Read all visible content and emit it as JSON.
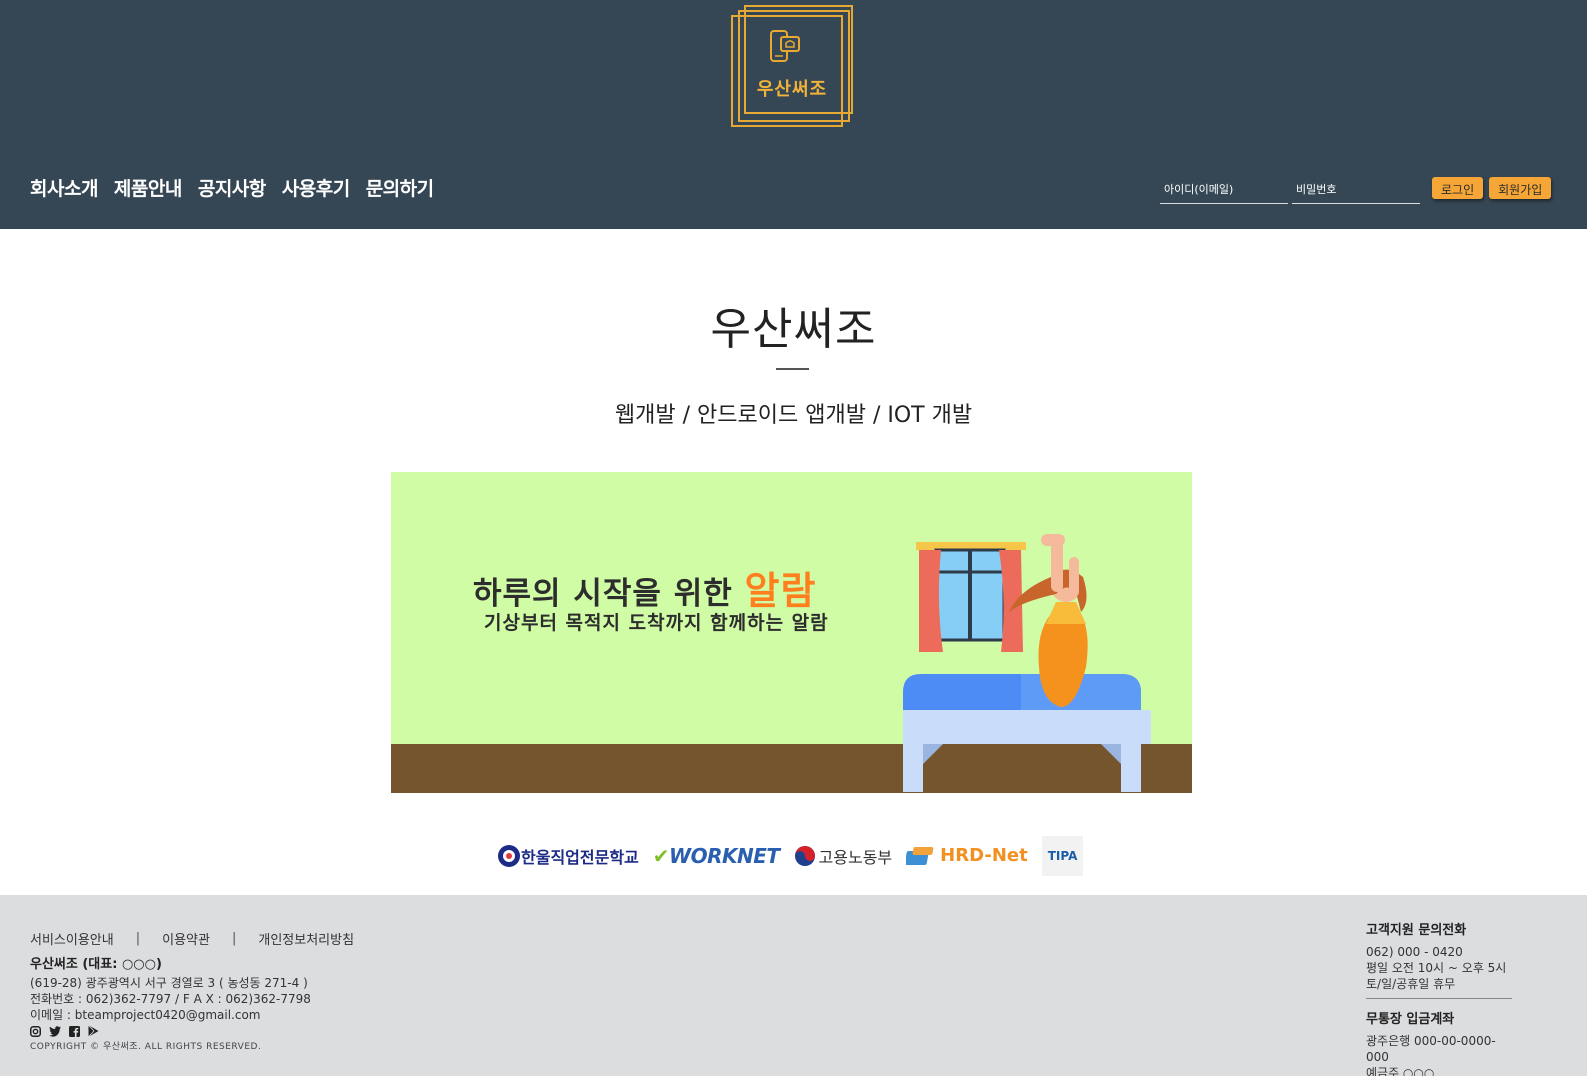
{
  "header": {
    "logo_text": "우산써조",
    "nav": [
      "회사소개",
      "제품안내",
      "공지사항",
      "사용후기",
      "문의하기"
    ],
    "login": {
      "id_placeholder": "아이디(이메일)",
      "pw_placeholder": "비밀번호",
      "login_label": "로그인",
      "signup_label": "회원가입"
    },
    "colors": {
      "background": "#354654",
      "accent": "#f5a636"
    }
  },
  "main": {
    "title": "우산써조",
    "subtitle": "웹개발 / 안드로이드 앱개발 / IOT 개발",
    "banner": {
      "headline": "하루의 시작을 위한 ",
      "headline_accent": "알람",
      "subline": "기상부터 목적지 도착까지 함께하는 알람"
    },
    "partners": [
      "한울직업전문학교",
      "WORKNET",
      "고용노동부",
      "HRD-Net",
      "TIPA"
    ]
  },
  "footer": {
    "links": [
      "서비스이용안내",
      "이용약관",
      "개인정보처리방침"
    ],
    "link_separator": "|",
    "company": "우산써조 (대표: ○○○)",
    "address": "(619-28) 광주광역시 서구 경열로 3 ( 농성동 271-4 )",
    "phone_fax": "전화번호 : 062)362-7797 / F A X : 062)362-7798",
    "email": "이메일 : bteamproject0420@gmail.com",
    "social_icons": [
      "instagram-icon",
      "twitter-icon",
      "facebook-icon",
      "play-store-icon"
    ],
    "copyright": "COPYRIGHT © 우산써조. ALL RIGHTS RESERVED.",
    "support": {
      "title": "고객지원 문의전화",
      "phone": "062) 000 - 0420",
      "hours": "평일 오전 10시 ~ 오후 5시",
      "holiday": "토/일/공휴일 휴무"
    },
    "bank": {
      "title": "무통장 입금계좌",
      "account": "광주은행 000-00-0000-000",
      "holder": "예금주 ○○○"
    }
  }
}
